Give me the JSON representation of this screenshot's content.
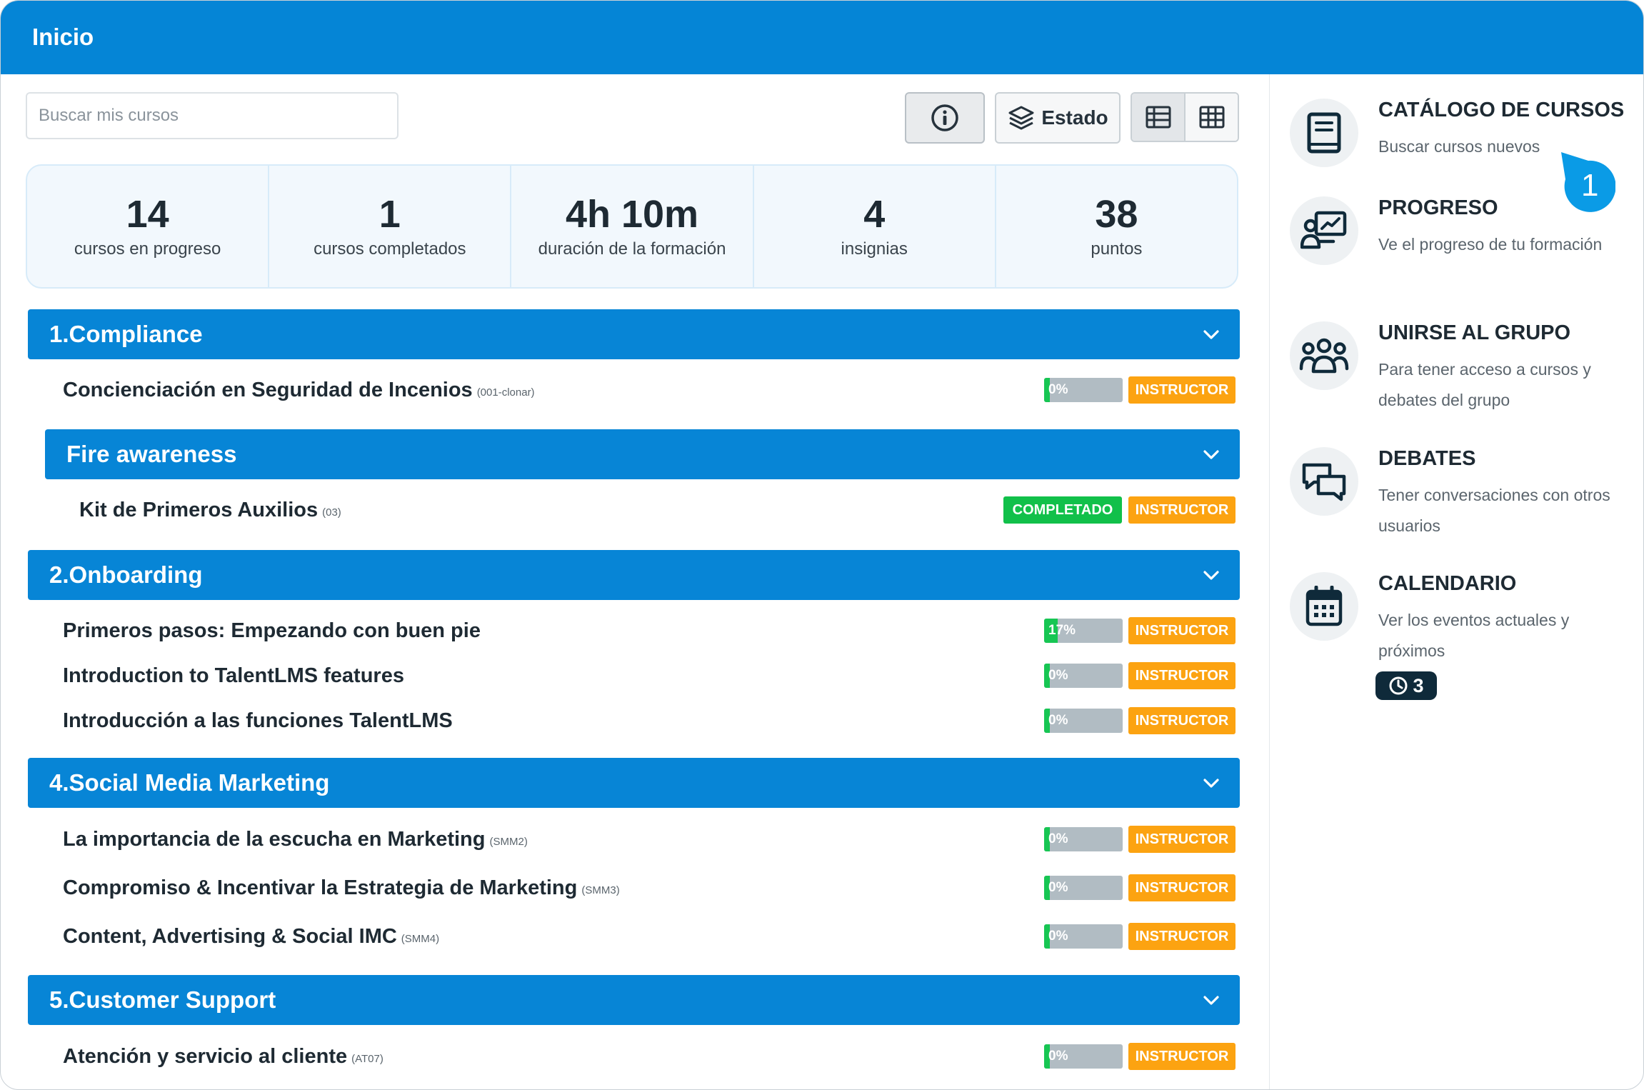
{
  "header": {
    "title": "Inicio"
  },
  "toolbar": {
    "search_placeholder": "Buscar mis cursos",
    "estado_label": "Estado"
  },
  "stats": [
    {
      "value": "14",
      "label": "cursos en progreso"
    },
    {
      "value": "1",
      "label": "cursos completados"
    },
    {
      "value": "4h 10m",
      "label": "duración de la formación"
    },
    {
      "value": "4",
      "label": "insignias"
    },
    {
      "value": "38",
      "label": "puntos"
    }
  ],
  "categories": [
    {
      "title": "1.Compliance",
      "courses": [
        {
          "name": "Concienciación en Seguridad de Incenios",
          "code": "(001-clonar)",
          "progress": "0%",
          "progress_fraction": 0.0,
          "badge": "INSTRUCTOR"
        }
      ],
      "subcategory": {
        "title": "Fire awareness",
        "courses": [
          {
            "name": "Kit de Primeros Auxilios",
            "code": "(03)",
            "status": "COMPLETADO",
            "badge": "INSTRUCTOR"
          }
        ]
      }
    },
    {
      "title": "2.Onboarding",
      "courses": [
        {
          "name": "Primeros pasos: Empezando con buen pie",
          "code": "",
          "progress": "17%",
          "progress_fraction": 0.17,
          "badge": "INSTRUCTOR"
        },
        {
          "name": "Introduction to TalentLMS features",
          "code": "",
          "progress": "0%",
          "progress_fraction": 0.0,
          "badge": "INSTRUCTOR"
        },
        {
          "name": "Introducción a las funciones TalentLMS",
          "code": "",
          "progress": "0%",
          "progress_fraction": 0.0,
          "badge": "INSTRUCTOR"
        }
      ]
    },
    {
      "title": "4.Social Media Marketing",
      "courses": [
        {
          "name": "La importancia de la escucha en Marketing",
          "code": "(SMM2)",
          "progress": "0%",
          "progress_fraction": 0.0,
          "badge": "INSTRUCTOR"
        },
        {
          "name": "Compromiso & Incentivar la Estrategia de Marketing",
          "code": "(SMM3)",
          "progress": "0%",
          "progress_fraction": 0.0,
          "badge": "INSTRUCTOR"
        },
        {
          "name": "Content, Advertising & Social IMC",
          "code": "(SMM4)",
          "progress": "0%",
          "progress_fraction": 0.0,
          "badge": "INSTRUCTOR"
        }
      ]
    },
    {
      "title": "5.Customer Support",
      "courses": [
        {
          "name": "Atención y servicio al cliente",
          "code": "(AT07)",
          "progress": "0%",
          "progress_fraction": 0.0,
          "badge": "INSTRUCTOR"
        }
      ]
    }
  ],
  "sidebar": {
    "items": [
      {
        "title": "CATÁLOGO DE CURSOS",
        "desc": "Buscar cursos nuevos",
        "icon": "book-icon"
      },
      {
        "title": "PROGRESO",
        "desc": "Ve el progreso de tu formación",
        "icon": "progress-chart-icon"
      },
      {
        "title": "UNIRSE AL GRUPO",
        "desc": "Para tener acceso a cursos y debates del grupo",
        "icon": "group-icon"
      },
      {
        "title": "DEBATES",
        "desc": "Tener conversaciones con otros usuarios",
        "icon": "chat-bubbles-icon"
      },
      {
        "title": "CALENDARIO",
        "desc": "Ver los eventos actuales y próximos",
        "icon": "calendar-icon"
      }
    ],
    "events_count": "3"
  },
  "annotation_marker": "1",
  "colors": {
    "brand_blue": "#0585d6",
    "instructor_orange": "#fca311",
    "completed_green": "#11c04a",
    "progress_green": "#17c653",
    "progress_track": "#b1bcc3"
  }
}
